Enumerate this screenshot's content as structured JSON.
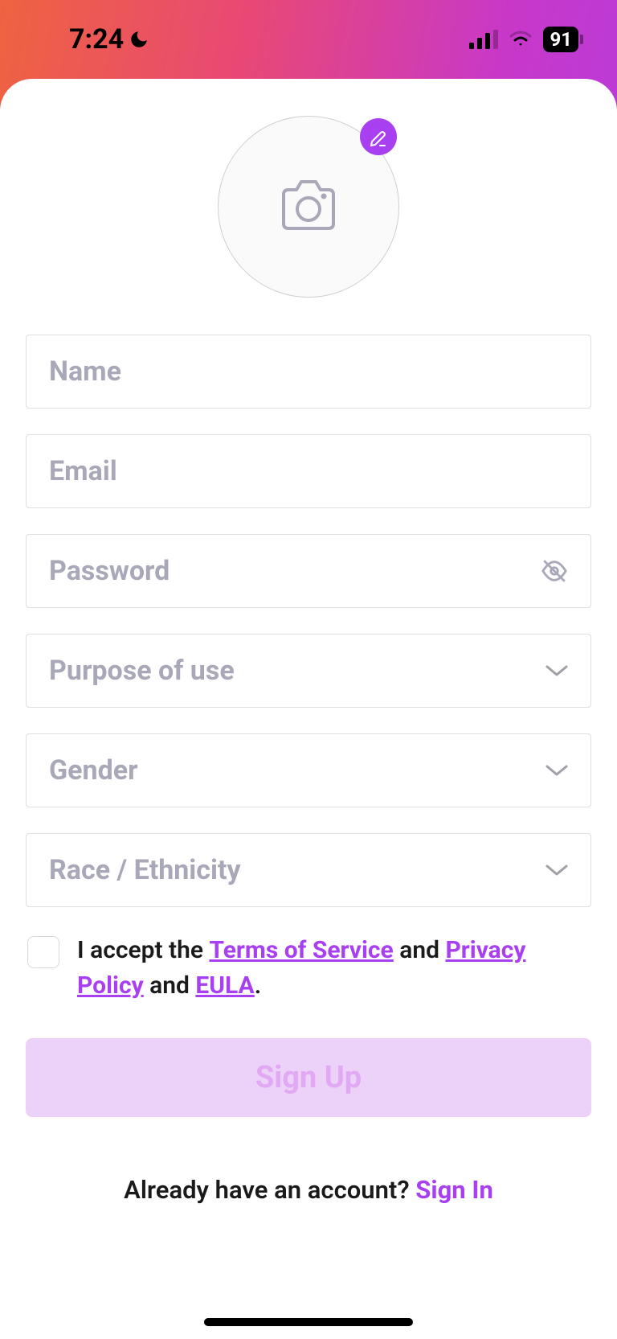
{
  "status": {
    "time": "7:24",
    "battery": "91"
  },
  "form": {
    "name_placeholder": "Name",
    "email_placeholder": "Email",
    "password_placeholder": "Password",
    "purpose_label": "Purpose of use",
    "gender_label": "Gender",
    "race_label": "Race / Ethnicity"
  },
  "consent": {
    "prefix": "I accept the ",
    "tos": "Terms of Service",
    "and1": " and ",
    "privacy": "Privacy Policy",
    "and2": " and ",
    "eula": "EULA",
    "suffix": "."
  },
  "signup_label": "Sign Up",
  "footer": {
    "question": "Already have an account? ",
    "signin": "Sign In"
  }
}
